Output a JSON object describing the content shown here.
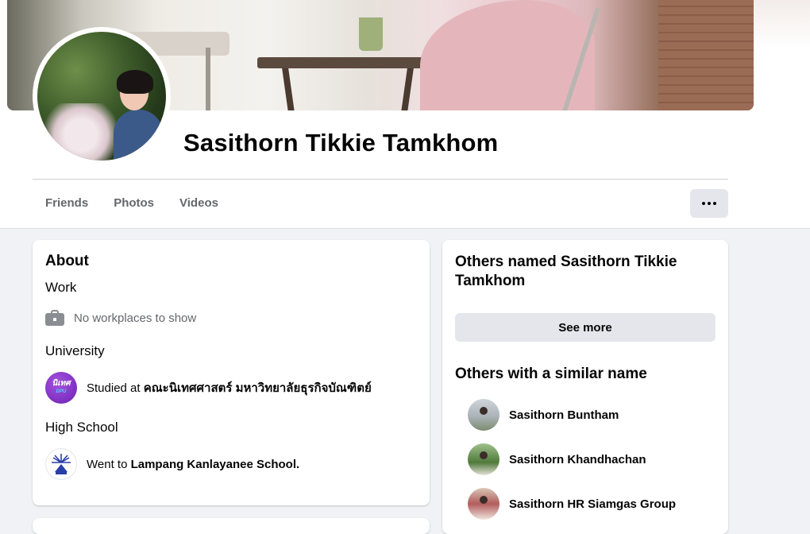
{
  "profile": {
    "name": "Sasithorn Tikkie Tamkhom"
  },
  "tabs": [
    {
      "label": "Friends"
    },
    {
      "label": "Photos"
    },
    {
      "label": "Videos"
    }
  ],
  "more_button_icon": "more-dots-icon",
  "about": {
    "title": "About",
    "work": {
      "heading": "Work",
      "icon": "briefcase-icon",
      "text": "No workplaces to show"
    },
    "university": {
      "heading": "University",
      "prefix": "Studied at ",
      "name": "คณะนิเทศศาสตร์ มหาวิทยาลัยธุรกิจบัณฑิตย์",
      "logo_text": "นิเทศ",
      "logo_sub": "DPU"
    },
    "high_school": {
      "heading": "High School",
      "prefix": "Went to ",
      "name": "Lampang Kanlayanee School."
    }
  },
  "others_named": {
    "title": "Others named Sasithorn Tikkie Tamkhom",
    "button": "See more"
  },
  "similar": {
    "title": "Others with a similar name",
    "people": [
      {
        "name": "Sasithorn Buntham"
      },
      {
        "name": "Sasithorn Khandhachan"
      },
      {
        "name": "Sasithorn HR Siamgas Group"
      }
    ]
  },
  "colors": {
    "background": "#f0f2f5",
    "card": "#ffffff",
    "muted_text": "#65676b",
    "button_gray": "#e4e6eb"
  }
}
